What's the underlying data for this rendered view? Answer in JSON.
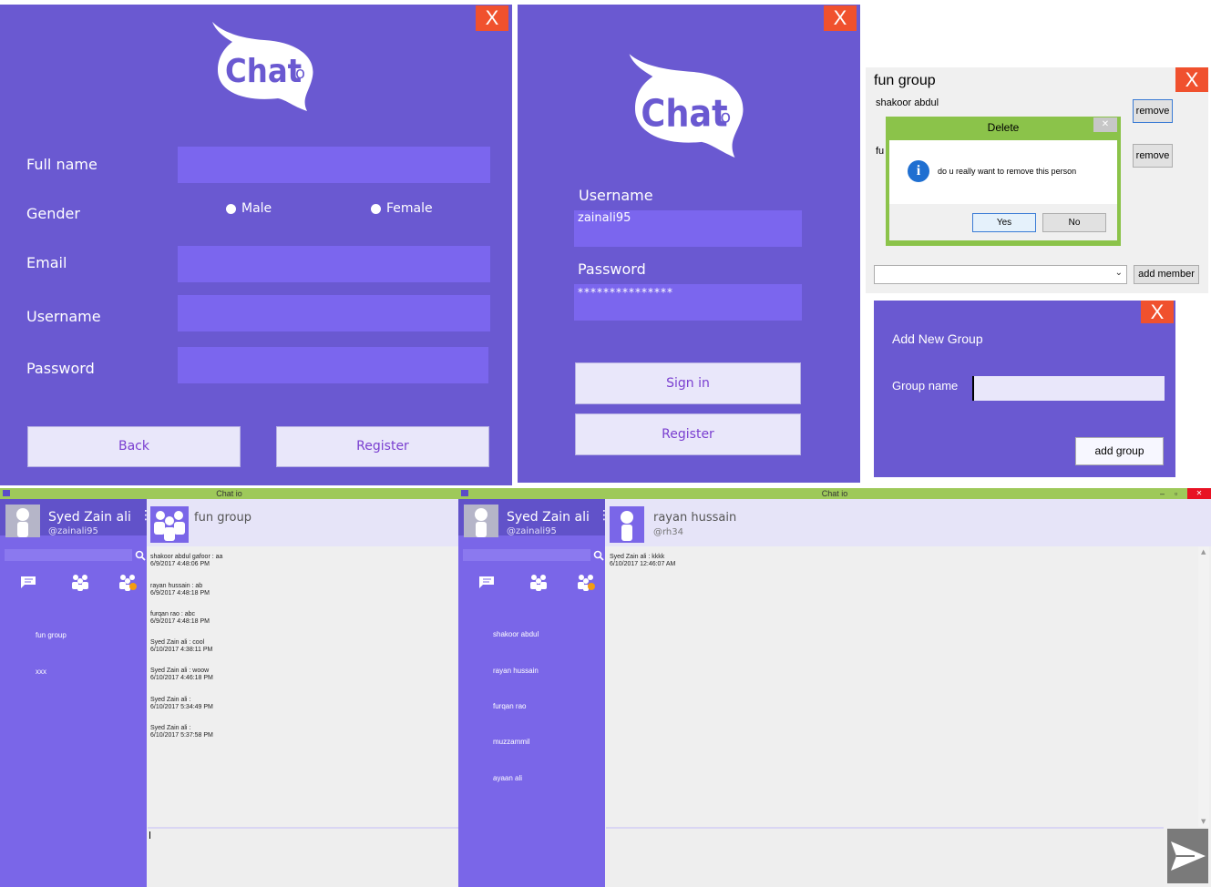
{
  "register": {
    "close": "X",
    "logo_main": "Chat",
    "logo_sub": "io",
    "labels": {
      "fullname": "Full name",
      "gender": "Gender",
      "email": "Email",
      "username": "Username",
      "password": "Password"
    },
    "gender_options": {
      "male": "Male",
      "female": "Female"
    },
    "back": "Back",
    "register": "Register"
  },
  "login": {
    "close": "X",
    "logo_main": "Chat",
    "logo_sub": "io",
    "username_label": "Username",
    "username_value": "zainali95",
    "password_label": "Password",
    "password_value": "***************",
    "signin": "Sign in",
    "register": "Register"
  },
  "group_mgmt": {
    "title": "fun group",
    "close": "X",
    "member1": "shakoor abdul",
    "member2_partial": "fu",
    "remove1": "remove",
    "remove2": "remove",
    "add_member": "add member",
    "dialog": {
      "title": "Delete",
      "close": "✕",
      "message": "do u really want to remove this person",
      "yes": "Yes",
      "no": "No"
    }
  },
  "add_group": {
    "close": "X",
    "title": "Add New Group",
    "group_name_label": "Group name",
    "add_btn": "add group"
  },
  "chat1": {
    "window_title": "Chat io",
    "user_name": "Syed Zain ali",
    "user_handle": "@zainali95",
    "chat_title": "fun group",
    "groups": [
      "fun group",
      "xxx"
    ],
    "messages": [
      {
        "line1": "shakoor abdul gafoor : aa",
        "line2": "6/9/2017 4:48:06 PM"
      },
      {
        "line1": "rayan hussain : ab",
        "line2": "6/9/2017 4:48:18 PM"
      },
      {
        "line1": "furqan rao : abc",
        "line2": "6/9/2017 4:48:18 PM"
      },
      {
        "line1": "Syed Zain ali : cool",
        "line2": "6/10/2017 4:38:11 PM"
      },
      {
        "line1": "Syed Zain ali : woow",
        "line2": "6/10/2017 4:46:18 PM"
      },
      {
        "line1": "Syed Zain ali :",
        "line2": "6/10/2017 5:34:49 PM"
      },
      {
        "line1": "Syed Zain ali :",
        "line2": "6/10/2017 5:37:58 PM"
      }
    ]
  },
  "chat2": {
    "window_title": "Chat io",
    "user_name": "Syed Zain ali",
    "user_handle": "@zainali95",
    "chat_title": "rayan hussain",
    "chat_handle": "@rh34",
    "contacts": [
      "shakoor abdul",
      "rayan hussain",
      "furqan rao",
      "muzzammil",
      "ayaan ali"
    ],
    "messages": [
      {
        "line1": "Syed Zain ali : kkkk",
        "line2": "6/10/2017 12:46:07 AM"
      }
    ],
    "window_controls": {
      "minimize": "–",
      "restore": "▫",
      "close": "✕"
    }
  },
  "colors": {
    "primary": "#6a59d1",
    "field": "#7b66ee",
    "close": "#f0512e",
    "titlebar": "#9ec95a"
  }
}
